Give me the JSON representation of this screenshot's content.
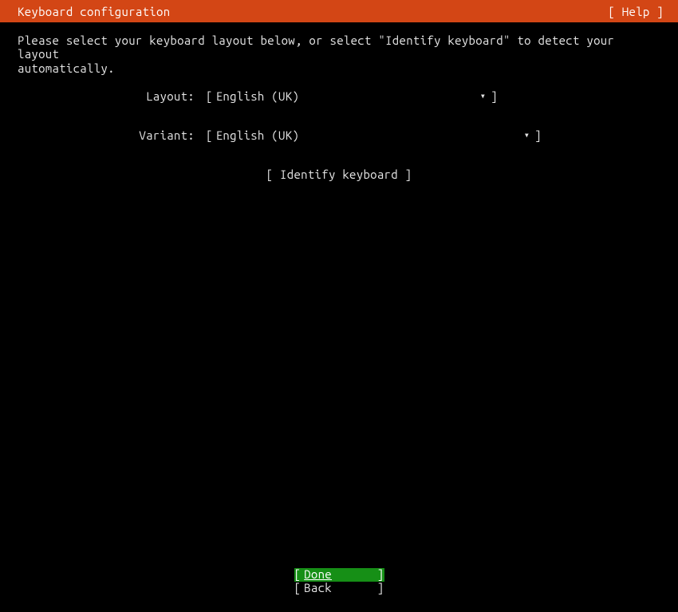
{
  "header": {
    "title": "Keyboard configuration",
    "help": "[ Help ]"
  },
  "instruction": "Please select your keyboard layout below, or select \"Identify keyboard\" to detect your layout\nautomatically.",
  "fields": {
    "layout": {
      "label": "Layout:",
      "value": "English (UK)"
    },
    "variant": {
      "label": "Variant:",
      "value": "English (UK)"
    }
  },
  "identify": {
    "label": "[ Identify keyboard ]"
  },
  "buttons": {
    "done": "Done",
    "back": "Back"
  }
}
